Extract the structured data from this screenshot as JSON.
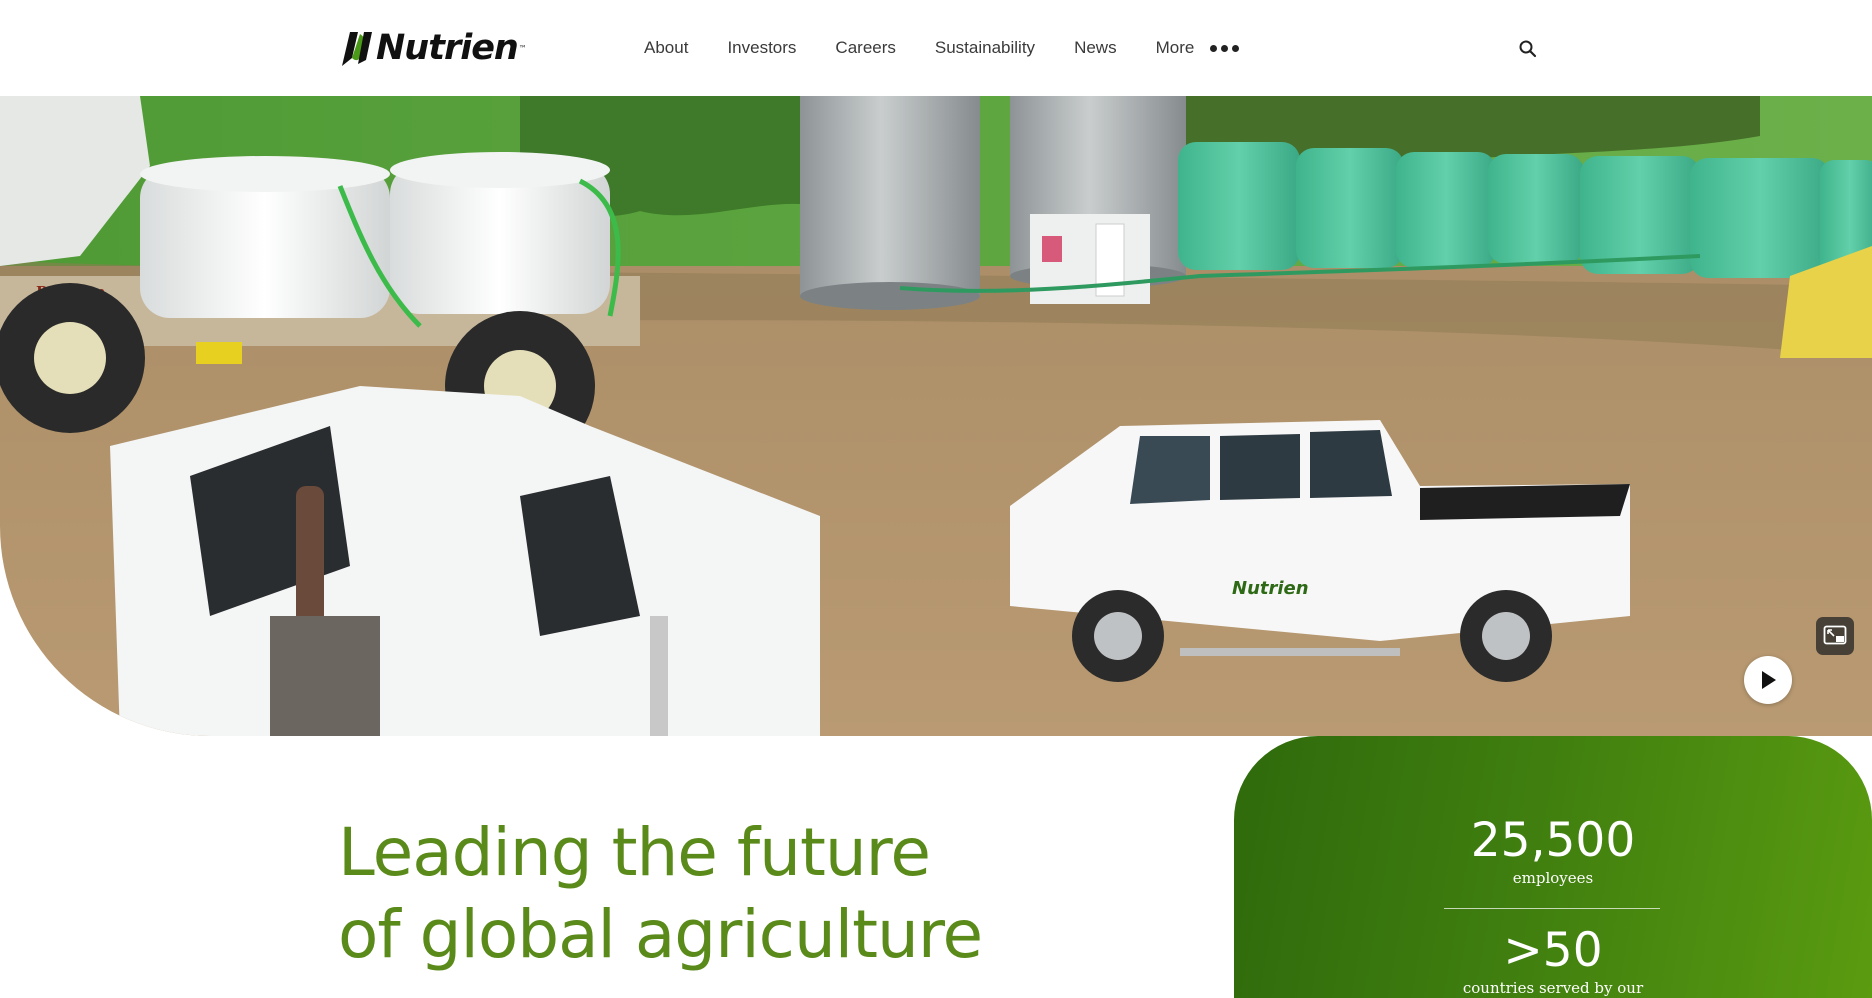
{
  "header": {
    "logo": {
      "text": "Nutrien",
      "trademark": "™",
      "icon": "nutrien-leaf-icon"
    },
    "nav": [
      {
        "label": "About"
      },
      {
        "label": "Investors"
      },
      {
        "label": "Careers"
      },
      {
        "label": "Sustainability"
      },
      {
        "label": "News"
      }
    ],
    "more": {
      "label": "More",
      "icon": "more-dots-icon"
    },
    "search": {
      "icon": "search-icon"
    }
  },
  "hero": {
    "media": "video",
    "truck_logo_text": "Nutrien",
    "trailer_brand": "Pattison",
    "controls": {
      "pip_icon": "picture-in-picture-icon",
      "play_icon": "play-icon"
    }
  },
  "headline": {
    "line1": "Leading the future",
    "line2": "of global agriculture"
  },
  "stats": [
    {
      "value": "25,500",
      "label": "employees"
    },
    {
      "value": ">50",
      "label": "countries served by our"
    }
  ],
  "colors": {
    "brand_green": "#5a8a1a",
    "panel_green_dark": "#2f6a0c",
    "panel_green_light": "#5a9b10",
    "nav_text": "#3a3a3a"
  }
}
